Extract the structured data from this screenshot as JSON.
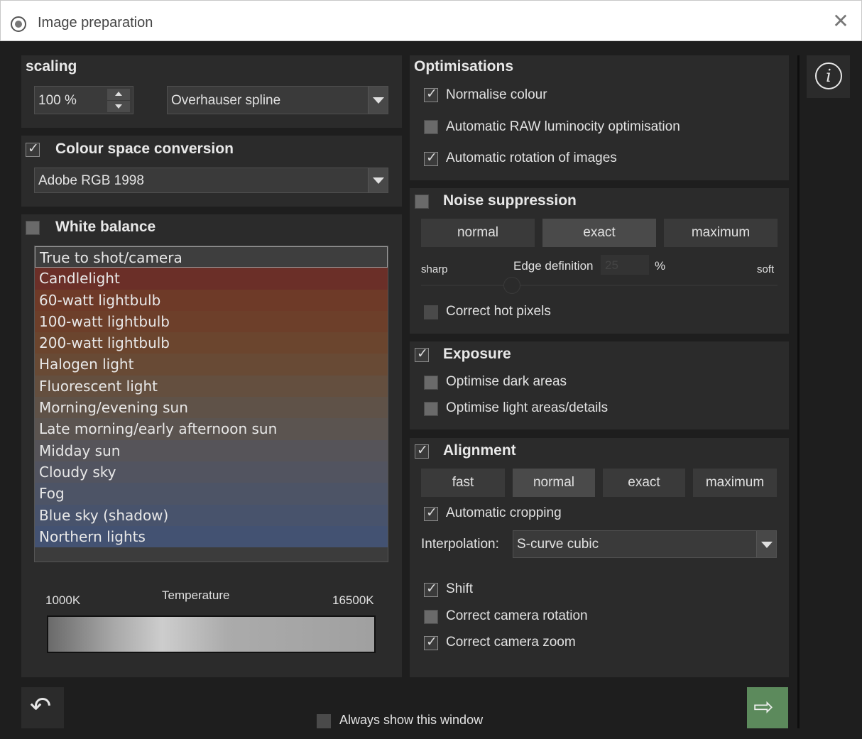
{
  "window": {
    "title": "Image preparation",
    "close_glyph": "✕"
  },
  "scaling": {
    "heading": "scaling",
    "percent_value": "100 %",
    "method_value": "Overhauser spline"
  },
  "colour_space": {
    "heading": "Colour space conversion",
    "checked": true,
    "value": "Adobe RGB 1998"
  },
  "white_balance": {
    "heading": "White balance",
    "checked": false,
    "items": [
      {
        "label": "True to shot/camera",
        "color": "#3e3e3e"
      },
      {
        "label": "Candlelight",
        "color": "#6b2f28"
      },
      {
        "label": "60-watt lightbulb",
        "color": "#6e3a28"
      },
      {
        "label": "100-watt lightbulb",
        "color": "#6d3f2a"
      },
      {
        "label": "200-watt lightbulb",
        "color": "#6b452e"
      },
      {
        "label": "Halogen light",
        "color": "#684a35"
      },
      {
        "label": "Fluorescent light",
        "color": "#644f3f"
      },
      {
        "label": "Morning/evening sun",
        "color": "#5f5248"
      },
      {
        "label": "Late morning/early afternoon sun",
        "color": "#5b5450"
      },
      {
        "label": "Midday sun",
        "color": "#565459"
      },
      {
        "label": "Cloudy sky",
        "color": "#525460"
      },
      {
        "label": "Fog",
        "color": "#4d5466"
      },
      {
        "label": "Blue sky (shadow)",
        "color": "#48536c"
      },
      {
        "label": "Northern lights",
        "color": "#435272"
      }
    ],
    "temperature": {
      "label": "Temperature",
      "min_label": "1000K",
      "max_label": "16500K"
    }
  },
  "optimisations": {
    "heading": "Optimisations",
    "items": [
      {
        "label": "Normalise colour",
        "checked": true
      },
      {
        "label": "Automatic RAW luminocity optimisation",
        "checked": false
      },
      {
        "label": "Automatic rotation of images",
        "checked": true
      }
    ]
  },
  "noise": {
    "heading": "Noise suppression",
    "checked": false,
    "modes": [
      {
        "label": "normal",
        "active": false
      },
      {
        "label": "exact",
        "active": true
      },
      {
        "label": "maximum",
        "active": false
      }
    ],
    "sharp_label": "sharp",
    "soft_label": "soft",
    "edge_label": "Edge definition",
    "edge_value": "25",
    "percent_sign": "%",
    "hot_pixels": {
      "label": "Correct hot pixels",
      "checked": false
    }
  },
  "exposure": {
    "heading": "Exposure",
    "checked": true,
    "items": [
      {
        "label": "Optimise dark areas",
        "checked": false
      },
      {
        "label": "Optimise light areas/details",
        "checked": false
      }
    ]
  },
  "alignment": {
    "heading": "Alignment",
    "checked": true,
    "modes": [
      {
        "label": "fast",
        "active": false
      },
      {
        "label": "normal",
        "active": true
      },
      {
        "label": "exact",
        "active": false
      },
      {
        "label": "maximum",
        "active": false
      }
    ],
    "auto_crop": {
      "label": "Automatic cropping",
      "checked": true
    },
    "interpolation_label": "Interpolation:",
    "interpolation_value": "S-curve cubic",
    "items": [
      {
        "label": "Shift",
        "checked": true
      },
      {
        "label": "Correct camera rotation",
        "checked": false
      },
      {
        "label": "Correct camera zoom",
        "checked": true
      }
    ]
  },
  "footer": {
    "always_show": {
      "label": "Always show this window",
      "checked": false
    }
  },
  "colors": {
    "ok_button": "#5c8a5c",
    "panel": "#2b2b2b",
    "background": "#1e1e1e"
  }
}
